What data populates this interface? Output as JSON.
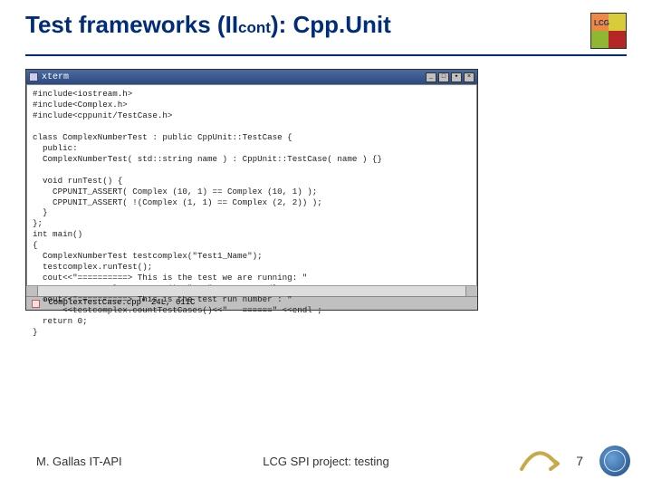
{
  "title": {
    "prefix": "Test frameworks (II",
    "subscript": "cont",
    "suffix": "): Cpp.Unit"
  },
  "logo_top": {
    "label": "LCG"
  },
  "editor": {
    "titlebar_text": "xterm",
    "window_buttons": [
      "_",
      "□",
      "▾",
      "×"
    ],
    "code": "#include<iostream.h>\n#include<Complex.h>\n#include<cppunit/TestCase.h>\n\nclass ComplexNumberTest : public CppUnit::TestCase {\n  public:\n  ComplexNumberTest( std::string name ) : CppUnit::TestCase( name ) {}\n\n  void runTest() {\n    CPPUNIT_ASSERT( Complex (10, 1) == Complex (10, 1) );\n    CPPUNIT_ASSERT( !(Complex (1, 1) == Complex (2, 2)) );\n  }\n};\nint main()\n{\n  ComplexNumberTest testcomplex(\"Test1_Name\");\n  testcomplex.runTest();\n  cout<<\"==========> This is the test we are running: \"\n      <<testcomplex.getName()<<\"   \"       <<endl ;\n  cout<<\"==========> This is the test run number : \"\n      <<testcomplex.countTestCases()<<\"   ======\" <<endl ;\n  return 0;\n}",
    "status_text": "\"ComplexTestCase.cpp\" 24L, 611C"
  },
  "footer": {
    "left": "M. Gallas   IT-API",
    "center": "LCG SPI project: testing",
    "page_number": "7"
  }
}
